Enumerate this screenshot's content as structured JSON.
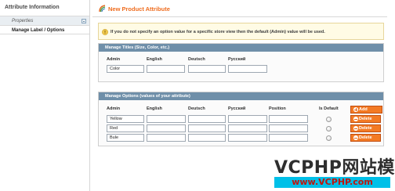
{
  "sidebar": {
    "title": "Attribute Information",
    "items": [
      {
        "label": "Properties"
      },
      {
        "label": "Manage Label / Options"
      }
    ]
  },
  "page": {
    "title": "New Product Attribute",
    "notice": "If you do not specify an option value for a specific store view then the default (Admin) value will be used."
  },
  "titles_panel": {
    "heading": "Manage Titles (Size, Color, etc.)",
    "columns": [
      "Admin",
      "English",
      "Deutsch",
      "Русский"
    ],
    "values": [
      "Color",
      "",
      "",
      ""
    ]
  },
  "options_panel": {
    "heading": "Manage Options (values of your attribute)",
    "columns": [
      "Admin",
      "English",
      "Deutsch",
      "Русский",
      "Position",
      "Is Default"
    ],
    "add_button": "Add Option",
    "delete_label": "Delete",
    "rows": [
      {
        "admin": "Yellow",
        "english": "",
        "deutsch": "",
        "russian": "",
        "position": ""
      },
      {
        "admin": "Red",
        "english": "",
        "deutsch": "",
        "russian": "",
        "position": ""
      },
      {
        "admin": "Bule",
        "english": "",
        "deutsch": "",
        "russian": "",
        "position": ""
      }
    ]
  },
  "watermark": {
    "title": "VCPHP网站模板",
    "url": "www.VCPHP.com"
  },
  "colors": {
    "accent": "#ef6c1e",
    "panel_header": "#6f8fa9",
    "button": "#f37a24",
    "watermark_bar": "#00c0e8"
  }
}
